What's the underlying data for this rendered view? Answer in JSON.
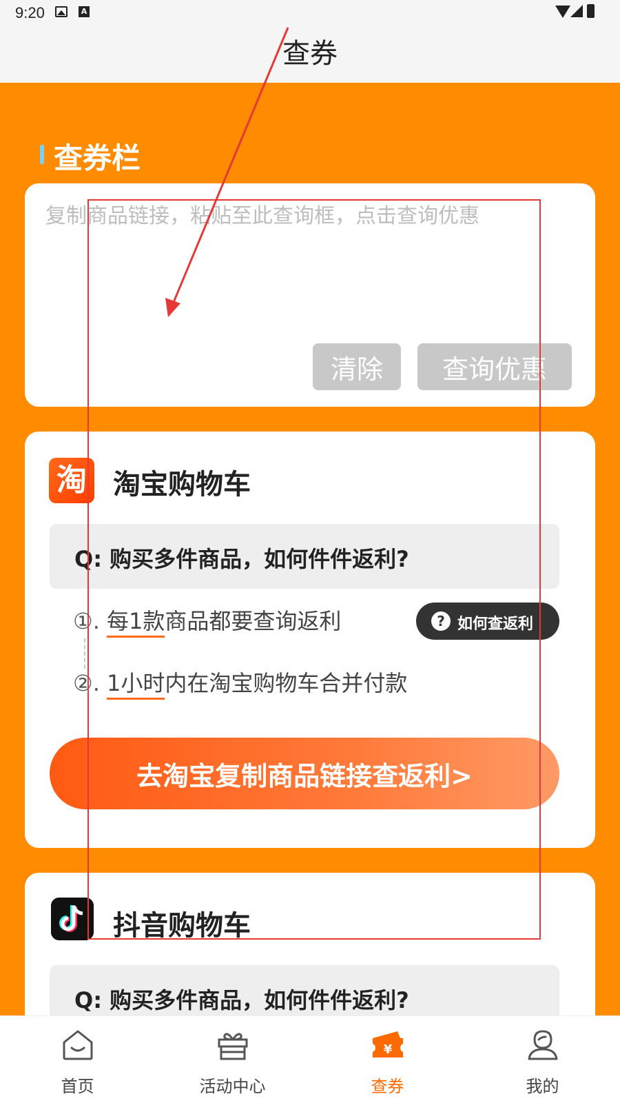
{
  "status_bar": {
    "time": "9:20",
    "icons": [
      "image-icon",
      "a-icon",
      "wifi-icon",
      "signal-icon",
      "battery-icon"
    ]
  },
  "header": {
    "title": "查券"
  },
  "section": {
    "title": "查券栏"
  },
  "query": {
    "placeholder": "复制商品链接，粘贴至此查询框，点击查询优惠",
    "value": "",
    "clear_label": "清除",
    "query_label": "查询优惠"
  },
  "taobao": {
    "logo_char": "淘",
    "title": "淘宝购物车",
    "question": "Q: 购买多件商品，如何件件返利?",
    "help_label": "如何查返利",
    "step1": {
      "num": "①.",
      "highlight": "每1款",
      "rest": "商品都要查询返利"
    },
    "step2": {
      "num": "②.",
      "highlight": "1小时",
      "rest": "内在淘宝购物车合并付款"
    },
    "action_label": "去淘宝复制商品链接查返利>"
  },
  "douyin": {
    "title": "抖音购物车",
    "question": "Q: 购买多件商品，如何件件返利?"
  },
  "bottom_nav": {
    "items": [
      {
        "label": "首页",
        "icon": "home-icon"
      },
      {
        "label": "活动中心",
        "icon": "gift-icon"
      },
      {
        "label": "查券",
        "icon": "coupon-icon",
        "active": true
      },
      {
        "label": "我的",
        "icon": "profile-icon"
      }
    ]
  },
  "colors": {
    "page_bg": "#ff8b00",
    "accent": "#ff6a00",
    "button_disabled": "#c8c8c8",
    "annotation": "#e53935"
  }
}
